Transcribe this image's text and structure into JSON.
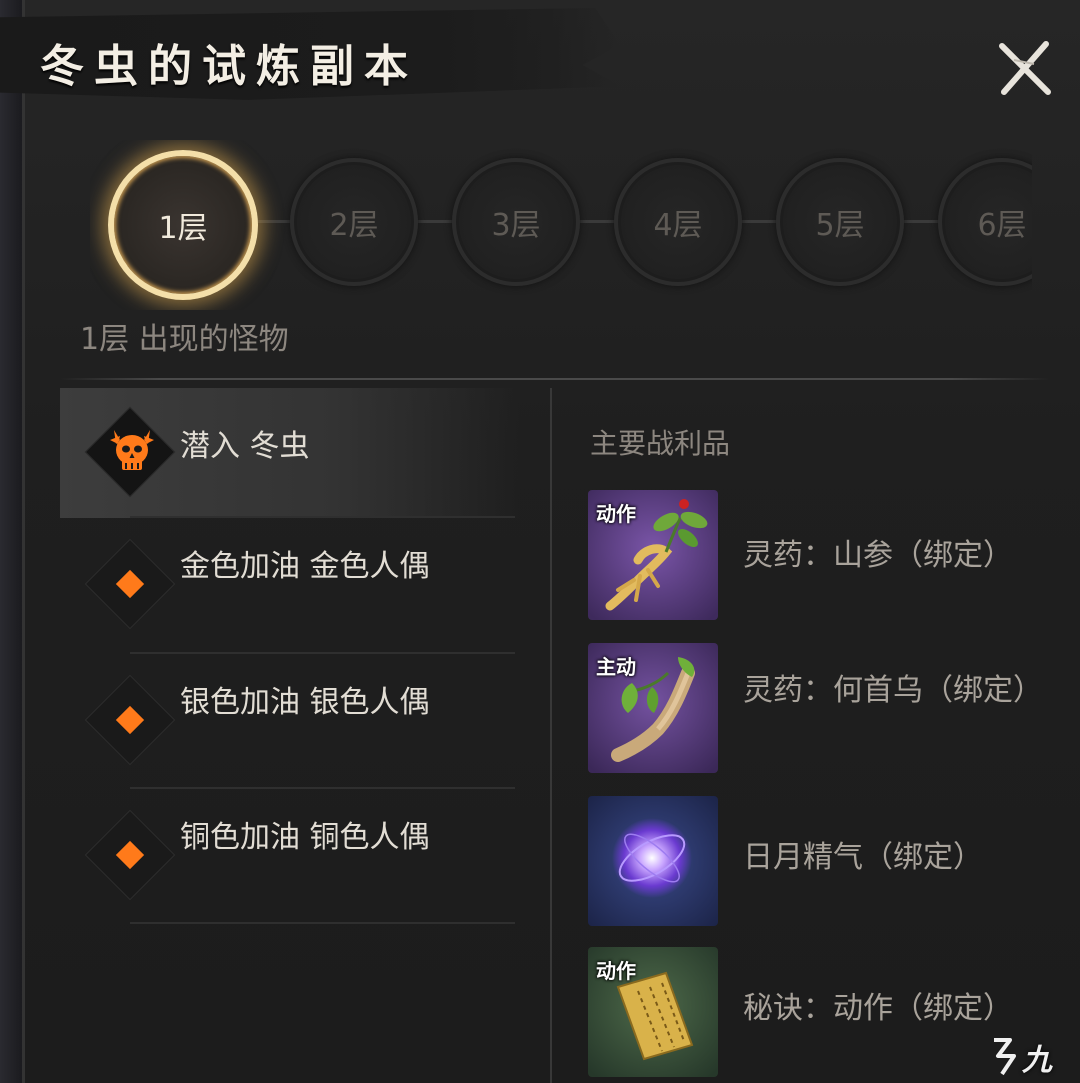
{
  "header": {
    "title": "冬虫的试炼副本"
  },
  "floors": [
    {
      "label": "1层",
      "active": true
    },
    {
      "label": "2层",
      "active": false
    },
    {
      "label": "3层",
      "active": false
    },
    {
      "label": "4层",
      "active": false
    },
    {
      "label": "5层",
      "active": false
    },
    {
      "label": "6层",
      "active": false
    }
  ],
  "monsters_section": {
    "title": "1层 出现的怪物"
  },
  "monsters": [
    {
      "name": "潜入 冬虫",
      "type": "boss",
      "icon": "demon-skull-icon"
    },
    {
      "name": "金色加油 金色人偶",
      "type": "normal",
      "icon": "orange-diamond-icon"
    },
    {
      "name": "银色加油 银色人偶",
      "type": "normal",
      "icon": "orange-diamond-icon"
    },
    {
      "name": "铜色加油 铜色人偶",
      "type": "normal",
      "icon": "orange-diamond-icon"
    }
  ],
  "loot_section": {
    "title": "主要战利品"
  },
  "loot": [
    {
      "name": "灵药：山参（绑定）",
      "tag": "动作",
      "icon": "ginseng-icon"
    },
    {
      "name": "灵药：何首乌（绑定）",
      "tag": "主动",
      "icon": "fleeceflower-root-icon"
    },
    {
      "name": "日月精气（绑定）",
      "tag": "",
      "icon": "energy-orb-icon"
    },
    {
      "name": "秘诀：动作（绑定）",
      "tag": "动作",
      "icon": "scroll-icon"
    }
  ],
  "watermark": {
    "text": "九游"
  },
  "colors": {
    "accent": "#ff7a1a",
    "active_ring": "#f4dfa9"
  }
}
